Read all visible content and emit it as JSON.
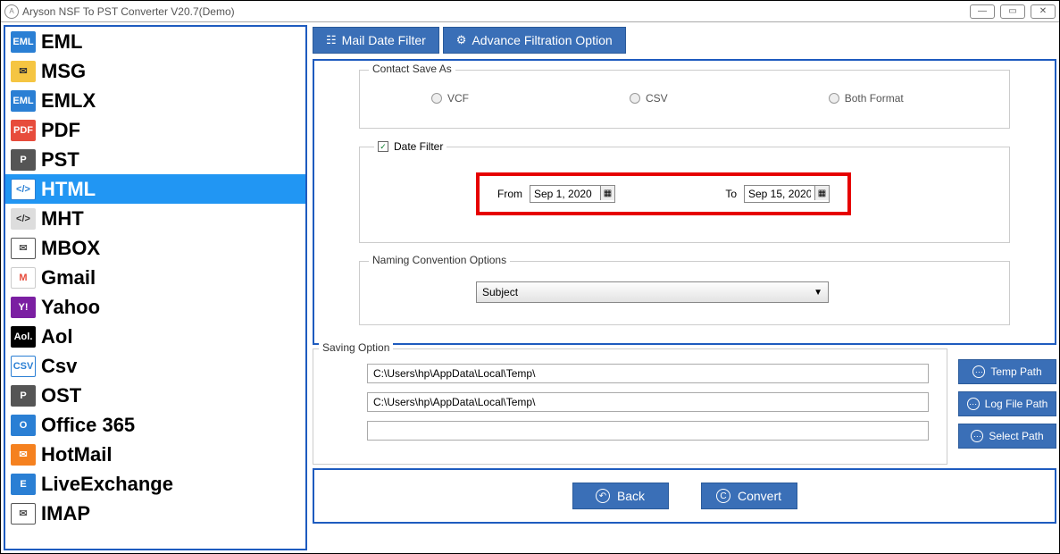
{
  "window": {
    "title": "Aryson NSF To PST Converter V20.7(Demo)"
  },
  "sidebar": {
    "items": [
      {
        "label": "EML",
        "iconText": "EML",
        "cls": "ic-eml"
      },
      {
        "label": "MSG",
        "iconText": "✉",
        "cls": "ic-msg"
      },
      {
        "label": "EMLX",
        "iconText": "EML",
        "cls": "ic-emlx"
      },
      {
        "label": "PDF",
        "iconText": "PDF",
        "cls": "ic-pdf"
      },
      {
        "label": "PST",
        "iconText": "P",
        "cls": "ic-pst"
      },
      {
        "label": "HTML",
        "iconText": "</>",
        "cls": "ic-html"
      },
      {
        "label": "MHT",
        "iconText": "</>",
        "cls": "ic-mht"
      },
      {
        "label": "MBOX",
        "iconText": "✉",
        "cls": "ic-mbox"
      },
      {
        "label": "Gmail",
        "iconText": "M",
        "cls": "ic-gmail"
      },
      {
        "label": "Yahoo",
        "iconText": "Y!",
        "cls": "ic-yahoo"
      },
      {
        "label": "Aol",
        "iconText": "Aol.",
        "cls": "ic-aol"
      },
      {
        "label": "Csv",
        "iconText": "CSV",
        "cls": "ic-csv"
      },
      {
        "label": "OST",
        "iconText": "P",
        "cls": "ic-ost"
      },
      {
        "label": "Office 365",
        "iconText": "O",
        "cls": "ic-o365"
      },
      {
        "label": "HotMail",
        "iconText": "✉",
        "cls": "ic-hotmail"
      },
      {
        "label": "LiveExchange",
        "iconText": "E",
        "cls": "ic-live"
      },
      {
        "label": "IMAP",
        "iconText": "✉",
        "cls": "ic-imap"
      }
    ],
    "selectedIndex": 5
  },
  "tabs": {
    "mailDateFilter": "Mail Date Filter",
    "advanceFiltration": "Advance Filtration Option"
  },
  "contact": {
    "groupTitle": "Contact Save As",
    "vcf": "VCF",
    "csv": "CSV",
    "both": "Both Format"
  },
  "dateFilter": {
    "checkLabel": "Date Filter",
    "fromLabel": "From",
    "fromValue": "Sep 1, 2020",
    "toLabel": "To",
    "toValue": "Sep 15, 2020"
  },
  "naming": {
    "groupTitle": "Naming Convention Options",
    "selected": "Subject"
  },
  "saving": {
    "groupTitle": "Saving Option",
    "tempPath": "C:\\Users\\hp\\AppData\\Local\\Temp\\",
    "logPath": "C:\\Users\\hp\\AppData\\Local\\Temp\\",
    "selectPath": "",
    "tempBtn": "Temp Path",
    "logBtn": "Log File Path",
    "selectBtn": "Select Path"
  },
  "footer": {
    "back": "Back",
    "convert": "Convert"
  }
}
